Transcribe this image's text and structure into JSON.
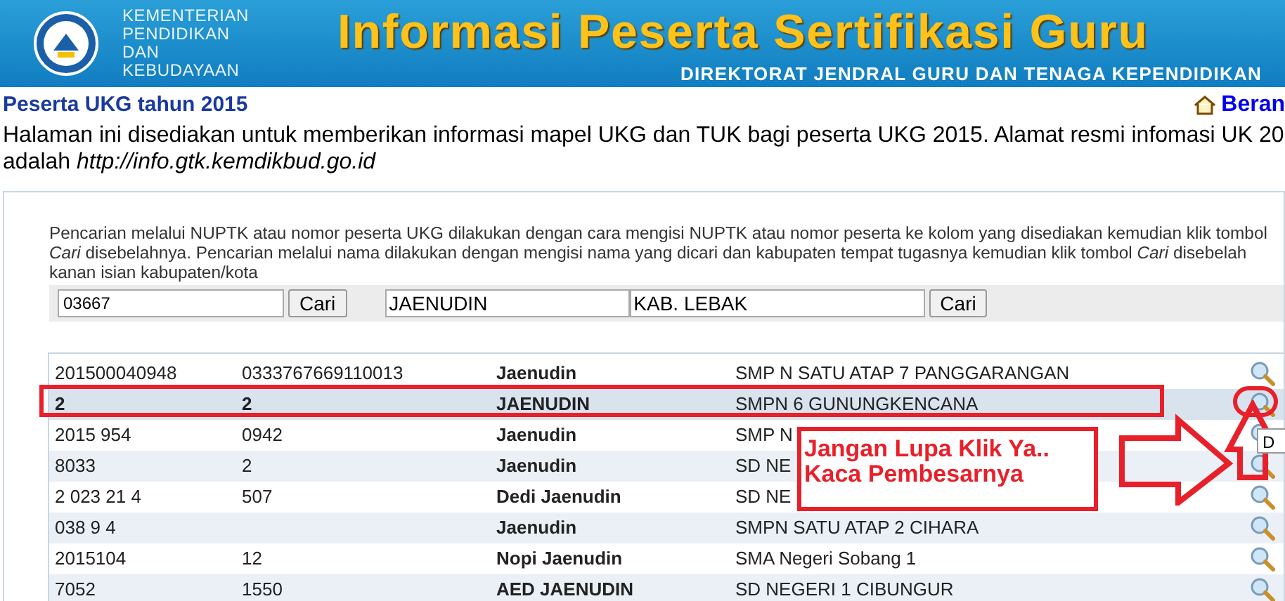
{
  "header": {
    "logo_text": [
      "KEMENTERIAN",
      "PENDIDIKAN",
      "DAN",
      "KEBUDAYAAN"
    ],
    "title": "Informasi Peserta Sertifikasi Guru",
    "subtitle": "DIREKTORAT JENDRAL GURU DAN TENAGA KEPENDIDIKAN"
  },
  "page_title": "Peserta UKG tahun 2015",
  "home_link": "Beran",
  "intro": "Halaman ini disediakan untuk memberikan informasi mapel UKG dan TUK bagi peserta UKG 2015. Alamat resmi infomasi UK 20",
  "intro_line2": "adalah *http://info.gtk.kemdikbud.go.id*",
  "instructions": "Pencarian melalui NUPTK atau nomor peserta UKG dilakukan dengan cara mengisi NUPTK atau nomor peserta ke kolom yang disediakan kemudian klik tombol *Cari* disebelahnya. Pencarian melalui nama dilakukan dengan mengisi nama yang dicari dan kabupaten tempat tugasnya kemudian klik tombol *Cari* disebelah kanan isian kabupaten/kota",
  "search": {
    "number_value": "03667",
    "button1": "Cari",
    "name_value": "JAENUDIN",
    "district_value": "KAB. LEBAK",
    "button2": "Cari"
  },
  "rows": [
    {
      "number": "201500040948",
      "nuptk": "0333767669110013",
      "name": "Jaenudin",
      "school": "SMP N SATU ATAP 7 PANGGARANGAN",
      "selected": false
    },
    {
      "number": "2",
      "nuptk": "2",
      "name": "JAENUDIN",
      "school": "SMPN 6 GUNUNGKENCANA",
      "selected": true
    },
    {
      "number": "2015 954",
      "nuptk": "0942",
      "name": "Jaenudin",
      "school": "SMP N",
      "selected": false
    },
    {
      "number": "8033",
      "nuptk": "2",
      "name": "Jaenudin",
      "school": "SD NE",
      "selected": false
    },
    {
      "number": "2 023 21 4",
      "nuptk": "507",
      "name": "Dedi Jaenudin",
      "school": "SD NE",
      "selected": false
    },
    {
      "number": "038 9 4",
      "name": "Jaenudin",
      "school": "SMPN SATU ATAP 2 CIHARA",
      "selected": false
    },
    {
      "number": "2015104",
      "nuptk": "12",
      "name": "Nopi Jaenudin",
      "school": "SMA Negeri Sobang 1",
      "selected": false
    },
    {
      "number": "7052",
      "nuptk": "1550",
      "name": "AED JAENUDIN",
      "school": "SD NEGERI 1 CIBUNGUR",
      "selected": false
    }
  ],
  "annotation": {
    "text": "Jangan Lupa Klik Ya.. Kaca Pembesarnya"
  },
  "tooltip": "D"
}
